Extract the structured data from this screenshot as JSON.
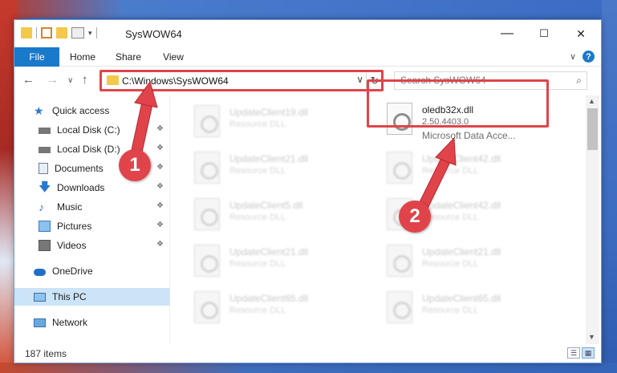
{
  "window": {
    "title": "SysWOW64"
  },
  "caption": {
    "minimize": "—",
    "maximize": "☐",
    "close": "✕"
  },
  "ribbon": {
    "tabs": [
      "File",
      "Home",
      "Share",
      "View"
    ],
    "collapse_glyph": "∨",
    "help_glyph": "?"
  },
  "nav": {
    "back_glyph": "←",
    "forward_glyph": "→",
    "recent_glyph": "∨",
    "up_glyph": "↑",
    "address_path": "C:\\Windows\\SysWOW64",
    "address_dropdown": "∨",
    "refresh_glyph": "↻",
    "search_placeholder": "Search SysWOW64",
    "search_icon_glyph": "⌕"
  },
  "sidebar": {
    "items": [
      {
        "label": "Quick access",
        "icon": "star-icon",
        "pinned": false
      },
      {
        "label": "Local Disk (C:)",
        "icon": "disk-icon",
        "pinned": true
      },
      {
        "label": "Local Disk (D:)",
        "icon": "disk-icon",
        "pinned": true
      },
      {
        "label": "Documents",
        "icon": "documents-icon",
        "pinned": true
      },
      {
        "label": "Downloads",
        "icon": "downloads-icon",
        "pinned": true
      },
      {
        "label": "Music",
        "icon": "music-icon",
        "pinned": true
      },
      {
        "label": "Pictures",
        "icon": "pictures-icon",
        "pinned": true
      },
      {
        "label": "Videos",
        "icon": "videos-icon",
        "pinned": true
      },
      {
        "label": "OneDrive",
        "icon": "cloud-icon",
        "pinned": false
      },
      {
        "label": "This PC",
        "icon": "computer-icon",
        "pinned": false,
        "selected": true
      },
      {
        "label": "Network",
        "icon": "network-icon",
        "pinned": false
      }
    ],
    "pin_glyph": "📌"
  },
  "files": {
    "left": [
      {
        "name": "UpdateClient19.dll",
        "desc": "Resource DLL"
      },
      {
        "name": "UpdateClient21.dll",
        "desc": "Resource DLL"
      },
      {
        "name": "UpdateClient5.dll",
        "desc": "Resource DLL"
      },
      {
        "name": "UpdateClient21.dll",
        "desc": "Resource DLL"
      },
      {
        "name": "UpdateClient65.dll",
        "desc": "Resource DLL"
      }
    ],
    "right": [
      {
        "name": "oledb32x.dll",
        "version": "2.50.4403.0",
        "desc": "Microsoft Data Acce..."
      },
      {
        "name": "UpdateClient42.dll",
        "desc": "Resource DLL"
      },
      {
        "name": "UpdateClient42.dll",
        "desc": "Resource DLL"
      },
      {
        "name": "UpdateClient21.dll",
        "desc": "Resource DLL"
      },
      {
        "name": "UpdateClient65.dll",
        "desc": "Resource DLL"
      }
    ]
  },
  "status": {
    "item_count": "187 items"
  },
  "annotations": {
    "step1": "1",
    "step2": "2",
    "color": "#e0444a"
  }
}
